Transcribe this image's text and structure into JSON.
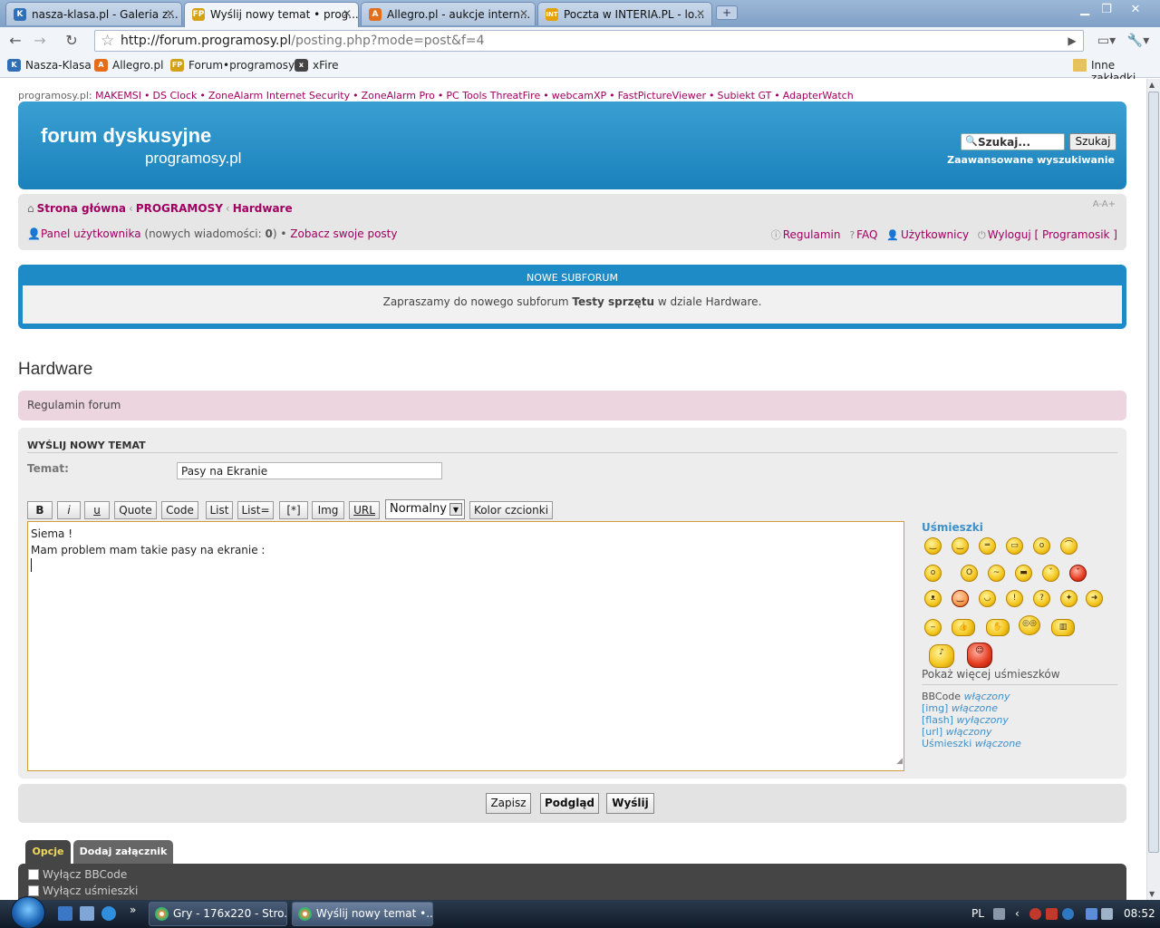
{
  "browser": {
    "tabs": [
      {
        "title": "nasza-klasa.pl - Galeria z...",
        "icon": "nk-favicon-icon",
        "color": "#2e6fb5"
      },
      {
        "title": "Wyślij nowy temat • prog...",
        "icon": "fp-favicon-icon",
        "color": "#d4a114",
        "active": true
      },
      {
        "title": "Allegro.pl - aukcje intern...",
        "icon": "allegro-favicon-icon",
        "color": "#e36d1a"
      },
      {
        "title": "Poczta w INTERIA.PL - lo...",
        "icon": "int-favicon-icon",
        "color": "#e5a100"
      }
    ],
    "url_host": "http://forum.programosy.pl",
    "url_path": "/posting.php?mode=post&f=4",
    "bookmarks": [
      {
        "label": "Nasza-Klasa",
        "icon_text": "K",
        "color": "#2e6fb5"
      },
      {
        "label": "Allegro.pl",
        "icon_text": "A",
        "color": "#e36d1a"
      },
      {
        "label": "Forum•programosy",
        "icon_text": "FP",
        "color": "#d4a114"
      },
      {
        "label": "xFire",
        "icon_text": "x",
        "color": "#444"
      }
    ],
    "other_bookmarks": "Inne zakładki"
  },
  "sponsor": {
    "prefix": "programosy.pl:",
    "links": [
      "MAKEMSI",
      "DS Clock",
      "ZoneAlarm Internet Security",
      "ZoneAlarm Pro",
      "PC Tools ThreatFire",
      "webcamXP",
      "FastPictureViewer",
      "Subiekt GT",
      "AdapterWatch"
    ]
  },
  "header": {
    "logo_line1": "forum dyskusyjne",
    "logo_line2": "programosy.pl",
    "search_placeholder": "Szukaj...",
    "search_button": "Szukaj",
    "advanced_search": "Zaawansowane wyszukiwanie",
    "brand_color": "#1e8bc7"
  },
  "navbar": {
    "breadcrumbs": [
      "Strona główna",
      "PROGRAMOSY",
      "Hardware"
    ],
    "font_size_control": "A-A+",
    "ucp_label": "Panel użytkownika",
    "new_messages_prefix": "(nowych wiadomości: ",
    "new_messages_count": "0",
    "new_messages_suffix": ")",
    "view_posts": "Zobacz swoje posty",
    "rules": "Regulamin",
    "faq": "FAQ",
    "members": "Użytkownicy",
    "logout": "Wyloguj [ Programosik ]"
  },
  "announcement": {
    "title": "NOWE SUBFORUM",
    "text_before": "Zapraszamy do nowego subforum ",
    "text_bold": "Testy sprzętu",
    "text_after": " w dziale Hardware."
  },
  "forum": {
    "title": "Hardware",
    "rules_link": "Regulamin forum"
  },
  "post": {
    "panel_title": "WYŚLIJ NOWY TEMAT",
    "subject_label": "Temat:",
    "subject_value": "Pasy na Ekranie",
    "format_buttons": [
      "B",
      "i",
      "u",
      "Quote",
      "Code",
      "List",
      "List=",
      "[*]",
      "Img",
      "URL"
    ],
    "font_size_value": "Normalny",
    "font_color_button": "Kolor czcionki",
    "message_lines": [
      "Siema !",
      "Mam problem mam takie pasy na ekranie :"
    ]
  },
  "smilies": {
    "title": "Uśmieszki",
    "show_more": "Pokaż więcej uśmieszków",
    "status": [
      {
        "label": "BBCode",
        "value": "włączony"
      },
      {
        "label": "[img]",
        "value": "włączone"
      },
      {
        "label": "[flash]",
        "value": "wyłączony"
      },
      {
        "label": "[url]",
        "value": "włączony"
      },
      {
        "label": "Uśmieszki",
        "value": "włączone"
      }
    ]
  },
  "actions": {
    "save": "Zapisz",
    "preview": "Podgląd",
    "submit": "Wyślij"
  },
  "options": {
    "tabs": [
      "Opcje",
      "Dodaj załącznik"
    ],
    "checkboxes": [
      "Wyłącz BBCode",
      "Wyłącz uśmieszki"
    ]
  },
  "taskbar": {
    "buttons": [
      "Gry - 176x220 - Stro...",
      "Wyślij nowy temat •..."
    ],
    "lang": "PL",
    "clock": "08:52"
  }
}
